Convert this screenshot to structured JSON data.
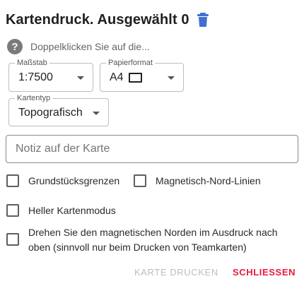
{
  "dialog": {
    "title": "Kartendruck. Ausgewählt 0",
    "hint": "Doppelklicken Sie auf die...",
    "help_icon_glyph": "?",
    "delete_icon": "trash-icon",
    "accent_color": "#3f6fd1"
  },
  "fields": {
    "scale": {
      "label": "Maßstab",
      "value": "1:7500"
    },
    "paper": {
      "label": "Papierformat",
      "value": "A4",
      "orientation_icon": "landscape-rectangle-icon"
    },
    "map_type": {
      "label": "Kartentyp",
      "value": "Topografisch"
    }
  },
  "note": {
    "placeholder": "Notiz auf der Karte",
    "value": ""
  },
  "options": {
    "parcel_borders": {
      "label": "Grundstücksgrenzen",
      "checked": false
    },
    "magnetic_north_lines": {
      "label": "Magnetisch-Nord-Linien",
      "checked": false
    },
    "light_map_mode": {
      "label": "Heller Kartenmodus",
      "checked": false
    },
    "rotate_magnetic_north": {
      "label": "Drehen Sie den magnetischen Norden im Ausdruck nach oben (sinnvoll nur beim Drucken von Teamkarten)",
      "checked": false
    }
  },
  "actions": {
    "print_label": "Karte drucken",
    "close_label": "Schliessen",
    "close_color": "#e8193f"
  }
}
